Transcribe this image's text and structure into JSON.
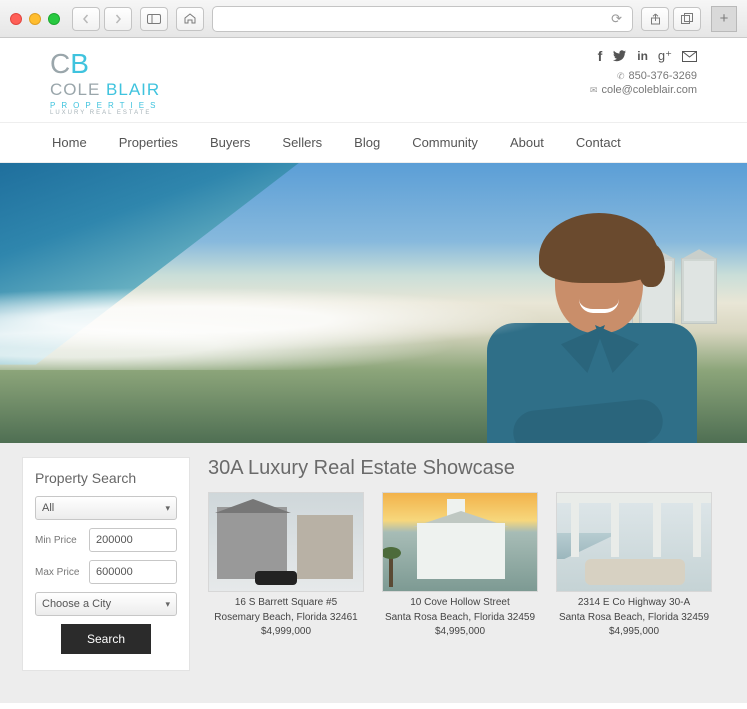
{
  "chrome": {
    "refresh_glyph": "⟳",
    "share_glyph": "⇪",
    "tabs_glyph": "⧉",
    "plus_glyph": "+"
  },
  "header": {
    "logo_c": "C",
    "logo_b": "B",
    "logo_name_a": "COLE ",
    "logo_name_b": "BLAIR",
    "logo_sub1": "PROPERTIES",
    "logo_sub2": "LUXURY REAL ESTATE",
    "phone": "850-376-3269",
    "email": "cole@coleblair.com",
    "social": {
      "facebook": "f",
      "twitter": "",
      "linkedin": "in",
      "google": "g⁺",
      "mail": "✉"
    }
  },
  "nav": {
    "items": [
      "Home",
      "Properties",
      "Buyers",
      "Sellers",
      "Blog",
      "Community",
      "About",
      "Contact"
    ]
  },
  "search": {
    "title": "Property Search",
    "type_select": "All",
    "min_label": "Min Price",
    "min_value": "200000",
    "max_label": "Max Price",
    "max_value": "600000",
    "city_select": "Choose a City",
    "button": "Search"
  },
  "showcase": {
    "title": "30A Luxury Real Estate Showcase",
    "listings": [
      {
        "line1": "16 S Barrett Square #5",
        "line2": "Rosemary Beach, Florida 32461",
        "price": "$4,999,000"
      },
      {
        "line1": "10 Cove Hollow Street",
        "line2": "Santa Rosa Beach, Florida 32459",
        "price": "$4,995,000"
      },
      {
        "line1": "2314 E Co Highway 30-A",
        "line2": "Santa Rosa Beach, Florida 32459",
        "price": "$4,995,000"
      }
    ]
  }
}
